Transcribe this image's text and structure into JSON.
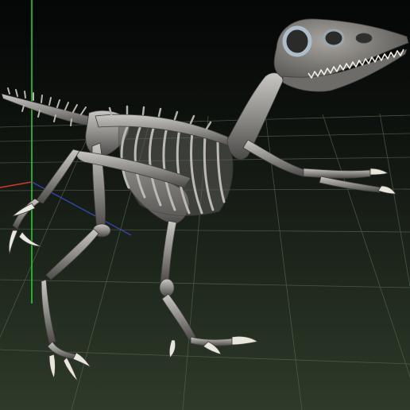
{
  "viewport": {
    "subject": "raptor-skeleton-model",
    "background_top": "#050606",
    "background_bottom": "#2e3a2a",
    "grid_color": "#56664f",
    "axis_y_color": "#1fd12a",
    "axis_x_color": "#d23a2a",
    "axis_z_color": "#3a4fd0",
    "bone_color": "#8f8d8a",
    "bone_highlight": "#c9c7c2",
    "bone_shadow": "#4b4a48",
    "claw_color": "#e9e6dc",
    "eye_ring_color": "#aebdca"
  }
}
